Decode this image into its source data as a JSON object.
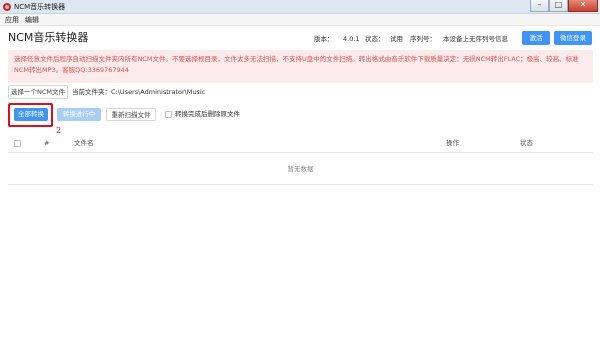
{
  "window": {
    "title": "NCM音乐转换器",
    "minimize_glyph": "–",
    "maximize_glyph": "□",
    "close_glyph": "✕"
  },
  "menu": {
    "items": [
      "应用",
      "编辑"
    ]
  },
  "header": {
    "title": "NCM音乐转换器",
    "version_label": "版本：",
    "version_value": "4.0.1",
    "status_label": "状态：",
    "status_value": "试用",
    "serial_label": "序列号：",
    "serial_value": "本设备上无序列号信息",
    "activate_label": "激活",
    "wechat_login_label": "微信登录"
  },
  "notice": {
    "text": "选择任意文件后程序自动扫描文件夹内所有NCM文件。不要选择根目录，文件太多无法扫描，不支持U盘中的文件扫描。转出格式由音乐软件下载质量决定：无损NCM转出FLAC；极高、较高、标准NCM转出MP3。客服QQ:3369767944"
  },
  "folder": {
    "select_button_label": "选择一个NCM文件",
    "current_label": "当前文件夹：",
    "current_path": "C:\\Users\\Administrator\\Music"
  },
  "actions": {
    "convert_all_label": "全部转换",
    "converting_label": "转换进行中",
    "rescan_label": "重新扫描文件",
    "delete_after_label": "转换完成后删除原文件",
    "delete_after_checked": false,
    "step_number": "2"
  },
  "table": {
    "columns": [
      "#",
      "文件名",
      "操作",
      "状态"
    ],
    "empty_text": "暂无数据"
  },
  "colors": {
    "accent": "#3f95f5",
    "highlight": "#e0101a",
    "notice_text": "#e05252",
    "notice_bg": "#fdeaea"
  }
}
